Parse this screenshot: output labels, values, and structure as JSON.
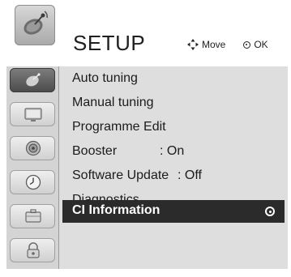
{
  "header": {
    "title": "SETUP",
    "hint_move": "Move",
    "hint_ok": "OK",
    "logo_icon": "satellite-dish-icon"
  },
  "sidebar": {
    "items": [
      {
        "icon": "satellite-dish-icon",
        "active": true
      },
      {
        "icon": "tv-screen-icon",
        "active": false
      },
      {
        "icon": "speaker-icon",
        "active": false
      },
      {
        "icon": "clock-icon",
        "active": false
      },
      {
        "icon": "briefcase-icon",
        "active": false
      },
      {
        "icon": "lock-icon",
        "active": false
      }
    ]
  },
  "menu": {
    "items": [
      {
        "label": "Auto tuning",
        "value": ""
      },
      {
        "label": "Manual tuning",
        "value": ""
      },
      {
        "label": "Programme Edit",
        "value": ""
      },
      {
        "label": "Booster",
        "value": ": On"
      },
      {
        "label": "Software Update",
        "value": ": Off"
      },
      {
        "label": "Diagnostics",
        "value": ""
      },
      {
        "label": "CI Information",
        "value": ""
      }
    ],
    "selected_index": 6
  },
  "colors": {
    "panel": "#dedede",
    "selected_bg": "#2b2b2b",
    "sidebar_bg": "#d4d4d4"
  }
}
